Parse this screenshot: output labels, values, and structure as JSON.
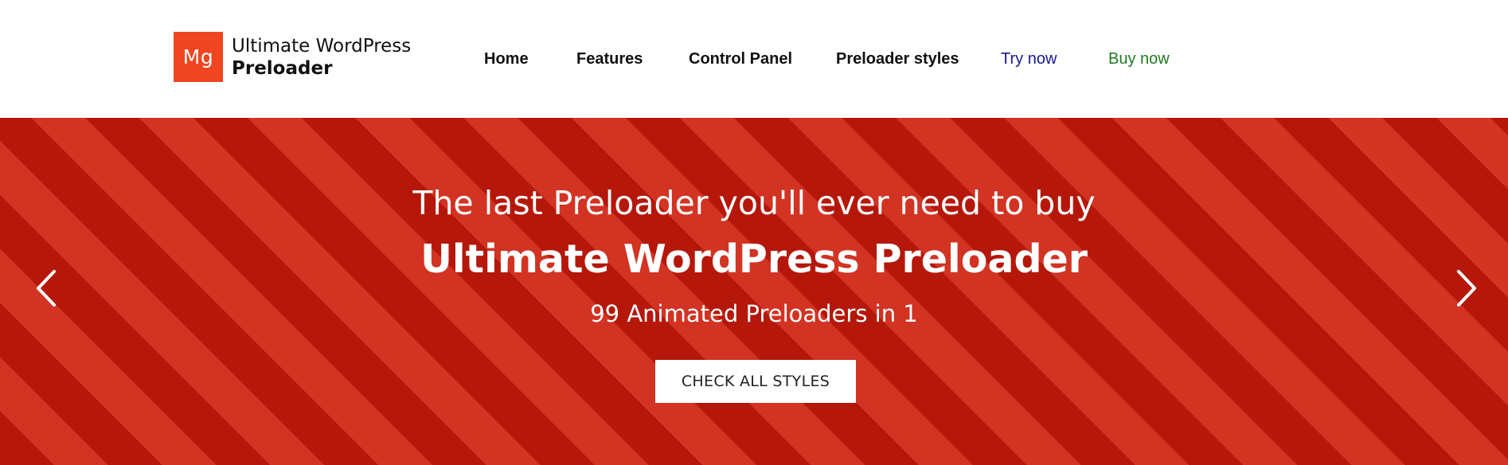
{
  "header": {
    "logo": {
      "mark": "Mg",
      "line1": "Ultimate WordPress",
      "line2": "Preloader"
    },
    "nav": [
      {
        "label": "Home"
      },
      {
        "label": "Features"
      },
      {
        "label": "Control Panel"
      },
      {
        "label": "Preloader styles"
      },
      {
        "label": "Try now"
      },
      {
        "label": "Buy now"
      }
    ]
  },
  "hero": {
    "tagline": "The last Preloader you'll ever need to buy",
    "title": "Ultimate WordPress Preloader",
    "subtitle": "99 Animated Preloaders in 1",
    "cta_label": "CHECK ALL STYLES",
    "prev_icon": "chevron-left-icon",
    "next_icon": "chevron-right-icon"
  },
  "colors": {
    "logo_bg": "#f04521",
    "stripe_dark": "#b5180a",
    "stripe_light": "#d23323",
    "try_now": "#1a1a8c",
    "buy_now": "#1f7a1f"
  }
}
